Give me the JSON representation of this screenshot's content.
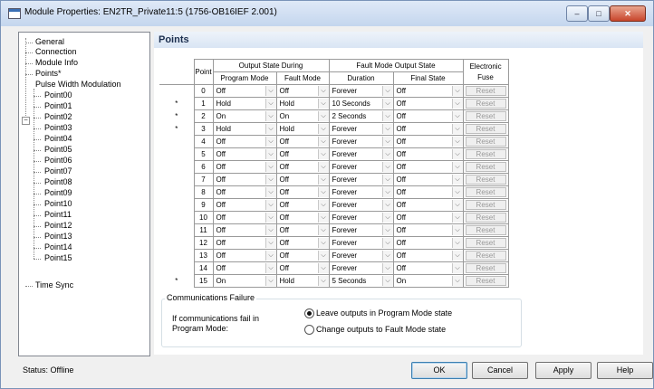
{
  "window": {
    "title": "Module Properties: EN2TR_Private11:5 (1756-OB16IEF 2.001)",
    "controls": {
      "minimize": "–",
      "maximize": "□",
      "close": "✕"
    }
  },
  "nav": {
    "items": [
      "General",
      "Connection",
      "Module Info",
      "Points*",
      "Pulse Width Modulation"
    ],
    "pwm_expander": "−",
    "points": [
      "Point00",
      "Point01",
      "Point02",
      "Point03",
      "Point04",
      "Point05",
      "Point06",
      "Point07",
      "Point08",
      "Point09",
      "Point10",
      "Point11",
      "Point12",
      "Point13",
      "Point14",
      "Point15"
    ],
    "last": "Time Sync"
  },
  "page": {
    "title": "Points"
  },
  "table": {
    "group_headers": [
      "Output State During",
      "Fault Mode Output State"
    ],
    "col_point": "Point",
    "col_fuse": "Electronic Fuse",
    "sub_headers": [
      "Program Mode",
      "Fault Mode",
      "Duration",
      "Final State"
    ],
    "reset_label": "Reset",
    "dropdown_glyph": "⌵",
    "rows": [
      {
        "mark": "",
        "point": "0",
        "program": "Off",
        "fault": "Off",
        "duration": "Forever",
        "final": "Off"
      },
      {
        "mark": "*",
        "point": "1",
        "program": "Hold",
        "fault": "Hold",
        "duration": "10 Seconds",
        "final": "Off"
      },
      {
        "mark": "*",
        "point": "2",
        "program": "On",
        "fault": "On",
        "duration": "2 Seconds",
        "final": "Off"
      },
      {
        "mark": "*",
        "point": "3",
        "program": "Hold",
        "fault": "Hold",
        "duration": "Forever",
        "final": "Off"
      },
      {
        "mark": "",
        "point": "4",
        "program": "Off",
        "fault": "Off",
        "duration": "Forever",
        "final": "Off"
      },
      {
        "mark": "",
        "point": "5",
        "program": "Off",
        "fault": "Off",
        "duration": "Forever",
        "final": "Off"
      },
      {
        "mark": "",
        "point": "6",
        "program": "Off",
        "fault": "Off",
        "duration": "Forever",
        "final": "Off"
      },
      {
        "mark": "",
        "point": "7",
        "program": "Off",
        "fault": "Off",
        "duration": "Forever",
        "final": "Off"
      },
      {
        "mark": "",
        "point": "8",
        "program": "Off",
        "fault": "Off",
        "duration": "Forever",
        "final": "Off"
      },
      {
        "mark": "",
        "point": "9",
        "program": "Off",
        "fault": "Off",
        "duration": "Forever",
        "final": "Off"
      },
      {
        "mark": "",
        "point": "10",
        "program": "Off",
        "fault": "Off",
        "duration": "Forever",
        "final": "Off"
      },
      {
        "mark": "",
        "point": "11",
        "program": "Off",
        "fault": "Off",
        "duration": "Forever",
        "final": "Off"
      },
      {
        "mark": "",
        "point": "12",
        "program": "Off",
        "fault": "Off",
        "duration": "Forever",
        "final": "Off"
      },
      {
        "mark": "",
        "point": "13",
        "program": "Off",
        "fault": "Off",
        "duration": "Forever",
        "final": "Off"
      },
      {
        "mark": "",
        "point": "14",
        "program": "Off",
        "fault": "Off",
        "duration": "Forever",
        "final": "Off"
      },
      {
        "mark": "*",
        "point": "15",
        "program": "On",
        "fault": "Hold",
        "duration": "5 Seconds",
        "final": "On"
      }
    ]
  },
  "comm_failure": {
    "title": "Communications Failure",
    "label": "If communications fail in Program Mode:",
    "options": [
      {
        "label": "Leave outputs in Program Mode state",
        "selected": true
      },
      {
        "label": "Change outputs to Fault Mode state",
        "selected": false
      }
    ]
  },
  "status": {
    "text": "Status:  Offline"
  },
  "buttons": {
    "ok": "OK",
    "cancel": "Cancel",
    "apply": "Apply",
    "help": "Help"
  }
}
